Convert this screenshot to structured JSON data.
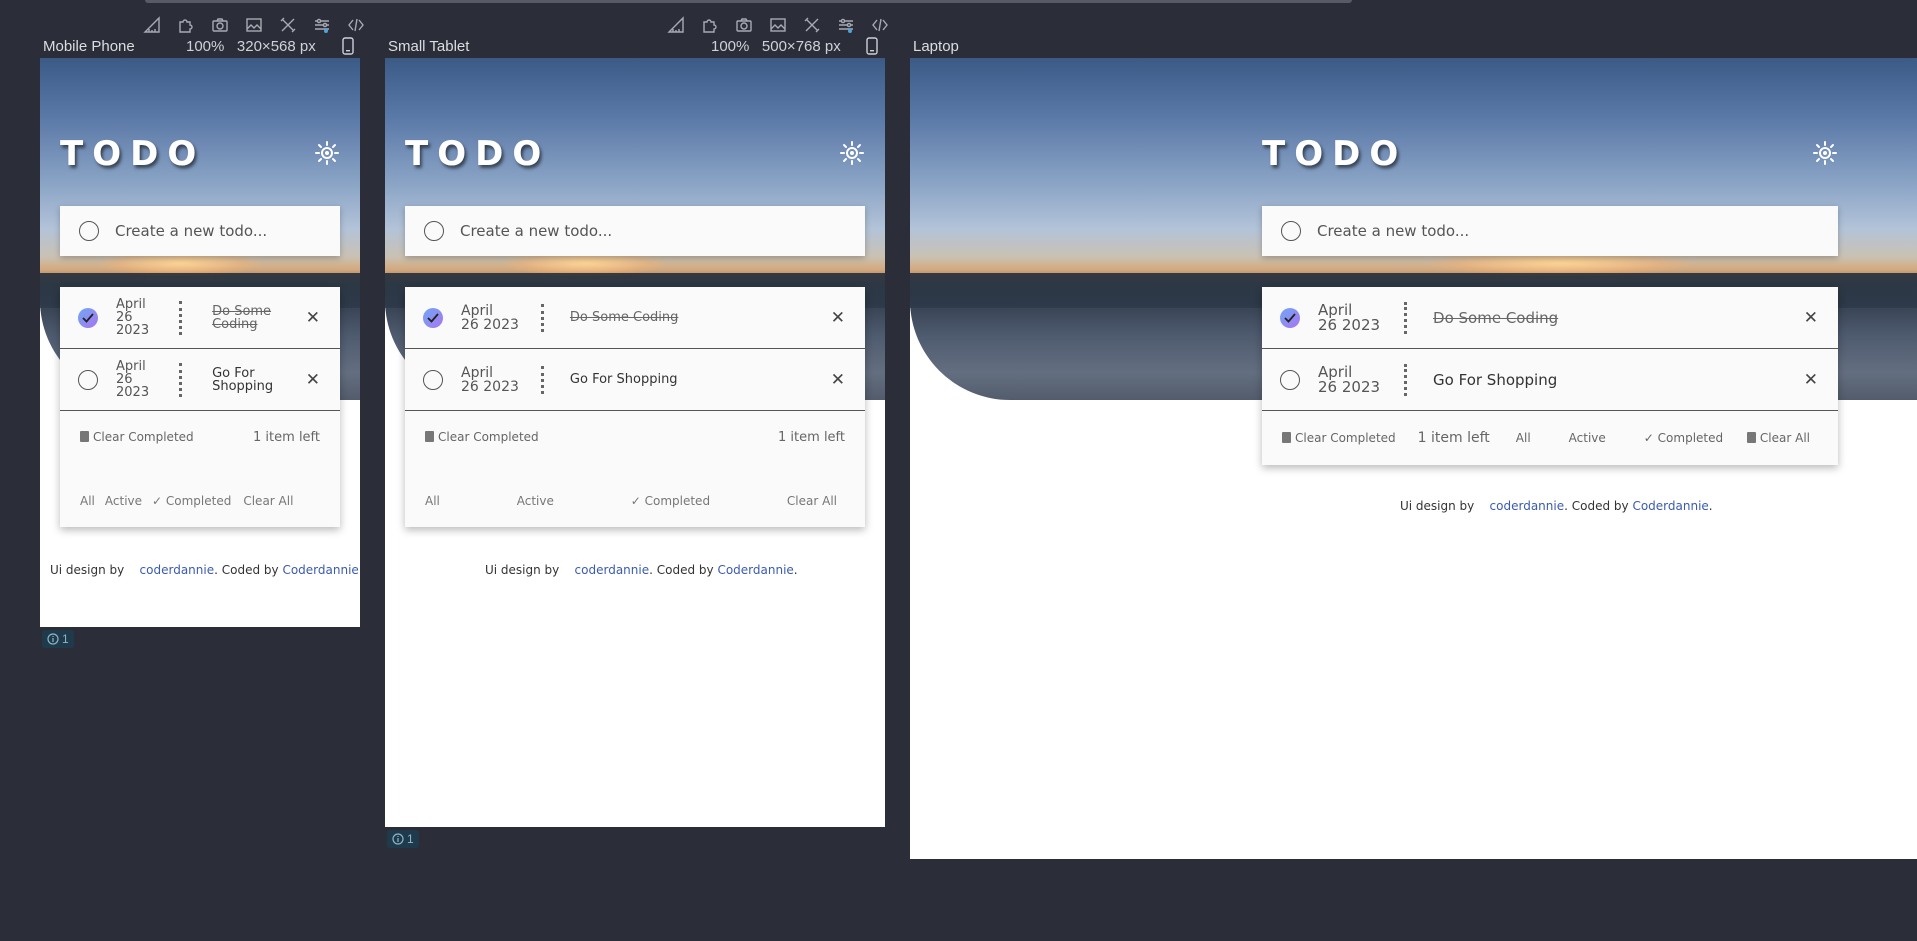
{
  "toolbar": {
    "icons": [
      "ruler-icon",
      "puzzle-icon",
      "camera-icon",
      "image-icon",
      "tools-icon",
      "sliders-icon",
      "code-icon"
    ]
  },
  "frames": [
    {
      "name": "Mobile Phone",
      "zoom": "100%",
      "width": "320",
      "times": "×",
      "height": "568",
      "unit": "px",
      "issues": "1"
    },
    {
      "name": "Small Tablet",
      "zoom": "100%",
      "width": "500",
      "times": "×",
      "height": "768",
      "unit": "px",
      "issues": "1"
    },
    {
      "name": "Laptop"
    }
  ],
  "app": {
    "title": "TODO",
    "new_todo_placeholder": "Create a new todo...",
    "todos": [
      {
        "date": "April 26 2023",
        "date_lines": [
          "April",
          "26",
          "2023"
        ],
        "date_lines_2": [
          "April",
          "26 2023"
        ],
        "text": "Do Some Coding",
        "text_lines": [
          "Do Some",
          "Coding"
        ],
        "completed": true
      },
      {
        "date": "April 26 2023",
        "date_lines": [
          "April",
          "26",
          "2023"
        ],
        "date_lines_2": [
          "April",
          "26 2023"
        ],
        "text": "Go For Shopping",
        "text_lines": [
          "Go For",
          "Shopping"
        ],
        "completed": false
      }
    ],
    "clear_completed": "Clear Completed",
    "items_left": "1 item left",
    "filters": {
      "all": "All",
      "active": "Active",
      "completed": "Completed",
      "clear_all": "Clear All"
    },
    "credit": {
      "prefix": "Ui design by",
      "designer": "coderdannie",
      "middle": ". Coded by ",
      "coder": "Coderdannie",
      "suffix": "."
    },
    "colors": {
      "check_gradient_start": "#6fa8f5",
      "check_gradient_end": "#a974f0",
      "link": "#3b5bb0"
    }
  }
}
